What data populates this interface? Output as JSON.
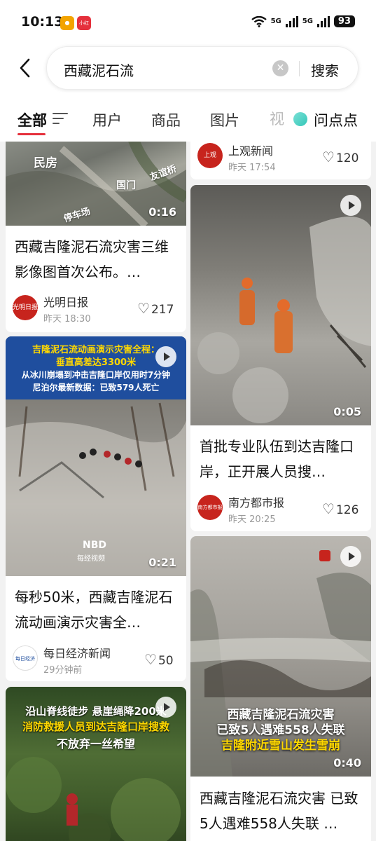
{
  "status_bar": {
    "time": "10:13",
    "net1": "5G",
    "net2": "5G",
    "battery": "93",
    "app_badge": "小红书"
  },
  "search": {
    "query": "西藏泥石流",
    "clear_icon": "x-circle-icon",
    "submit_label": "搜索"
  },
  "tabs": [
    {
      "label": "全部",
      "active": true
    },
    {
      "label": "用户"
    },
    {
      "label": "商品"
    },
    {
      "label": "图片"
    },
    {
      "label": "视"
    },
    {
      "label": "问点点"
    }
  ],
  "feed": {
    "left": [
      {
        "image_labels": [
          "民房",
          "国门",
          "友谊桥",
          "停车场"
        ],
        "duration": "0:16",
        "title": "西藏吉隆泥石流灾害三维影像图首次公布。…",
        "source": "光明日报",
        "logo_text": "光明日报",
        "time": "昨天 18:30",
        "likes": "217"
      },
      {
        "overlay_lines": [
          "吉隆泥石流动画演示灾害全程：",
          "垂直高差达3300米",
          "从冰川崩塌到冲击吉隆口岸仅用时7分钟",
          "尼泊尔最新数据：已致579人死亡"
        ],
        "watermark": "每经视频",
        "watermark_top": "NBD",
        "duration": "0:21",
        "title": "每秒50米，西藏吉隆泥石流动画演示灾害全…",
        "source": "每日经济新闻",
        "logo_text": "每日经济新闻",
        "time": "29分钟前",
        "likes": "50"
      },
      {
        "overlay_lines": [
          "沿山脊线徒步 悬崖绳降200米",
          "消防救援人员到达吉隆口岸搜救",
          "不放弃一丝希望"
        ]
      }
    ],
    "right": [
      {
        "source": "上观新闻",
        "logo_text": "上观",
        "time": "昨天 17:54",
        "likes": "120"
      },
      {
        "duration": "0:05",
        "title": "首批专业队伍到达吉隆口岸，正开展人员搜…",
        "source": "南方都市报",
        "logo_text": "南方都市报",
        "time": "昨天 20:25",
        "likes": "126"
      },
      {
        "overlay_lines": [
          "西藏吉隆泥石流灾害",
          "已致5人遇难558人失联",
          "吉隆附近雪山发生雪崩"
        ],
        "duration": "0:40",
        "title": "西藏吉隆泥石流灾害 已致5人遇难558人失联 …"
      }
    ]
  },
  "colors": {
    "accent": "#e5303c",
    "bg": "#f2f2f2",
    "overlay_blue": "#1f4e9e",
    "overlay_yellow": "#ffd800"
  }
}
